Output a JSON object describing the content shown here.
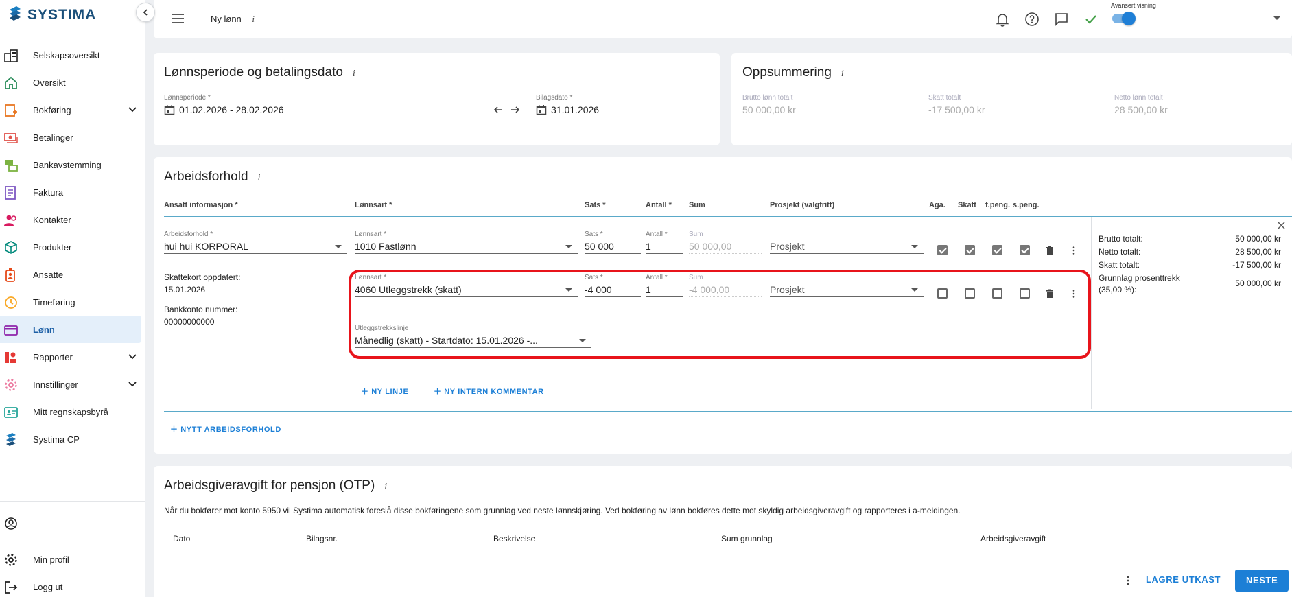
{
  "brand": {
    "name": "SYSTIMA",
    "color": "#1a4f7a"
  },
  "sidebar": {
    "items": [
      {
        "label": "Selskapsoversikt",
        "icon": "company-overview-icon"
      },
      {
        "label": "Oversikt",
        "icon": "home-icon"
      },
      {
        "label": "Bokføring",
        "icon": "bookkeeping-icon",
        "expandable": true
      },
      {
        "label": "Betalinger",
        "icon": "payments-icon"
      },
      {
        "label": "Bankavstemming",
        "icon": "bank-reconciliation-icon"
      },
      {
        "label": "Faktura",
        "icon": "invoice-icon"
      },
      {
        "label": "Kontakter",
        "icon": "contacts-icon"
      },
      {
        "label": "Produkter",
        "icon": "products-icon"
      },
      {
        "label": "Ansatte",
        "icon": "employees-icon"
      },
      {
        "label": "Timeføring",
        "icon": "time-tracking-icon"
      },
      {
        "label": "Lønn",
        "icon": "salary-icon",
        "active": true
      },
      {
        "label": "Rapporter",
        "icon": "reports-icon",
        "expandable": true
      },
      {
        "label": "Innstillinger",
        "icon": "settings-icon",
        "expandable": true
      },
      {
        "label": "Mitt regnskapsbyrå",
        "icon": "accounting-firm-icon"
      },
      {
        "label": "Systima CP",
        "icon": "systima-cp-icon"
      }
    ],
    "bottom": [
      {
        "label": "Min profil",
        "icon": "gear-icon"
      },
      {
        "label": "Logg ut",
        "icon": "logout-icon"
      }
    ]
  },
  "topbar": {
    "page_name": "Ny lønn",
    "info": "i",
    "advanced_view_label": "Avansert visning",
    "advanced_view_on": true
  },
  "period_card": {
    "title": "Lønnsperiode og betalingsdato",
    "info": "i",
    "period_label": "Lønnsperiode *",
    "period_value": "01.02.2026 - 28.02.2026",
    "voucher_date_label": "Bilagsdato *",
    "voucher_date_value": "31.01.2026"
  },
  "summary_card": {
    "title": "Oppsummering",
    "info": "i",
    "gross_label": "Brutto lønn totalt",
    "gross_value": "50 000,00 kr",
    "tax_label": "Skatt totalt",
    "tax_value": "-17 500,00 kr",
    "net_label": "Netto lønn totalt",
    "net_value": "28 500,00 kr"
  },
  "employment_card": {
    "title": "Arbeidsforhold",
    "info": "i",
    "columns": {
      "employee": "Ansatt informasjon *",
      "pay_type": "Lønnsart *",
      "rate": "Sats *",
      "quantity": "Antall *",
      "sum": "Sum",
      "project": "Prosjekt (valgfritt)",
      "aga": "Aga.",
      "tax": "Skatt",
      "fpeng": "f.peng.",
      "speng": "s.peng."
    },
    "employment_label": "Arbeidsforhold *",
    "employment_value": "hui hui KORPORAL",
    "tax_card_label": "Skattekort oppdatert:",
    "tax_card_date": "15.01.2026",
    "bank_label": "Bankkonto nummer:",
    "bank_value": "00000000000",
    "lines": [
      {
        "pay_type_label": "Lønnsart *",
        "pay_type": "1010 Fastlønn",
        "rate_label": "Sats *",
        "rate": "50 000",
        "qty_label": "Antall *",
        "qty": "1",
        "sum_label": "Sum",
        "sum": "50 000,00",
        "project": "Prosjekt",
        "checks": [
          true,
          true,
          true,
          true
        ]
      },
      {
        "pay_type_label": "Lønnsart *",
        "pay_type": "4060 Utleggstrekk (skatt)",
        "rate_label": "Sats *",
        "rate": "-4 000",
        "qty_label": "Antall *",
        "qty": "1",
        "sum_label": "Sum",
        "sum": "-4 000,00",
        "project": "Prosjekt",
        "checks": [
          false,
          false,
          false,
          false
        ],
        "deduction_line_label": "Utleggstrekkslinje",
        "deduction_line_value": "Månedlig (skatt) - Startdato: 15.01.2026 -..."
      }
    ],
    "new_line": "NY LINJE",
    "new_comment": "NY INTERN KOMMENTAR",
    "new_employment": "NYTT ARBEIDSFORHOLD",
    "totals": {
      "gross_label": "Brutto totalt:",
      "gross_value": "50 000,00 kr",
      "net_label": "Netto totalt:",
      "net_value": "28 500,00 kr",
      "tax_label": "Skatt totalt:",
      "tax_value": "-17 500,00 kr",
      "basis_label_1": "Grunnlag prosenttrekk",
      "basis_label_2": "(35,00 %):",
      "basis_value": "50 000,00 kr"
    }
  },
  "otp_card": {
    "title": "Arbeidsgiveravgift for pensjon (OTP)",
    "info": "i",
    "description": "Når du bokfører mot konto 5950 vil Systima automatisk foreslå disse bokføringene som grunnlag ved neste lønnskjøring. Ved bokføring av lønn bokføres dette mot skyldig arbeidsgiveravgift og rapporteres i a-meldingen.",
    "columns": [
      "Dato",
      "Bilagsnr.",
      "Beskrivelse",
      "Sum grunnlag",
      "Arbeidsgiveravgift"
    ]
  },
  "footer": {
    "save_draft": "LAGRE UTKAST",
    "next": "NESTE",
    "accent": "#1c7fd6"
  }
}
